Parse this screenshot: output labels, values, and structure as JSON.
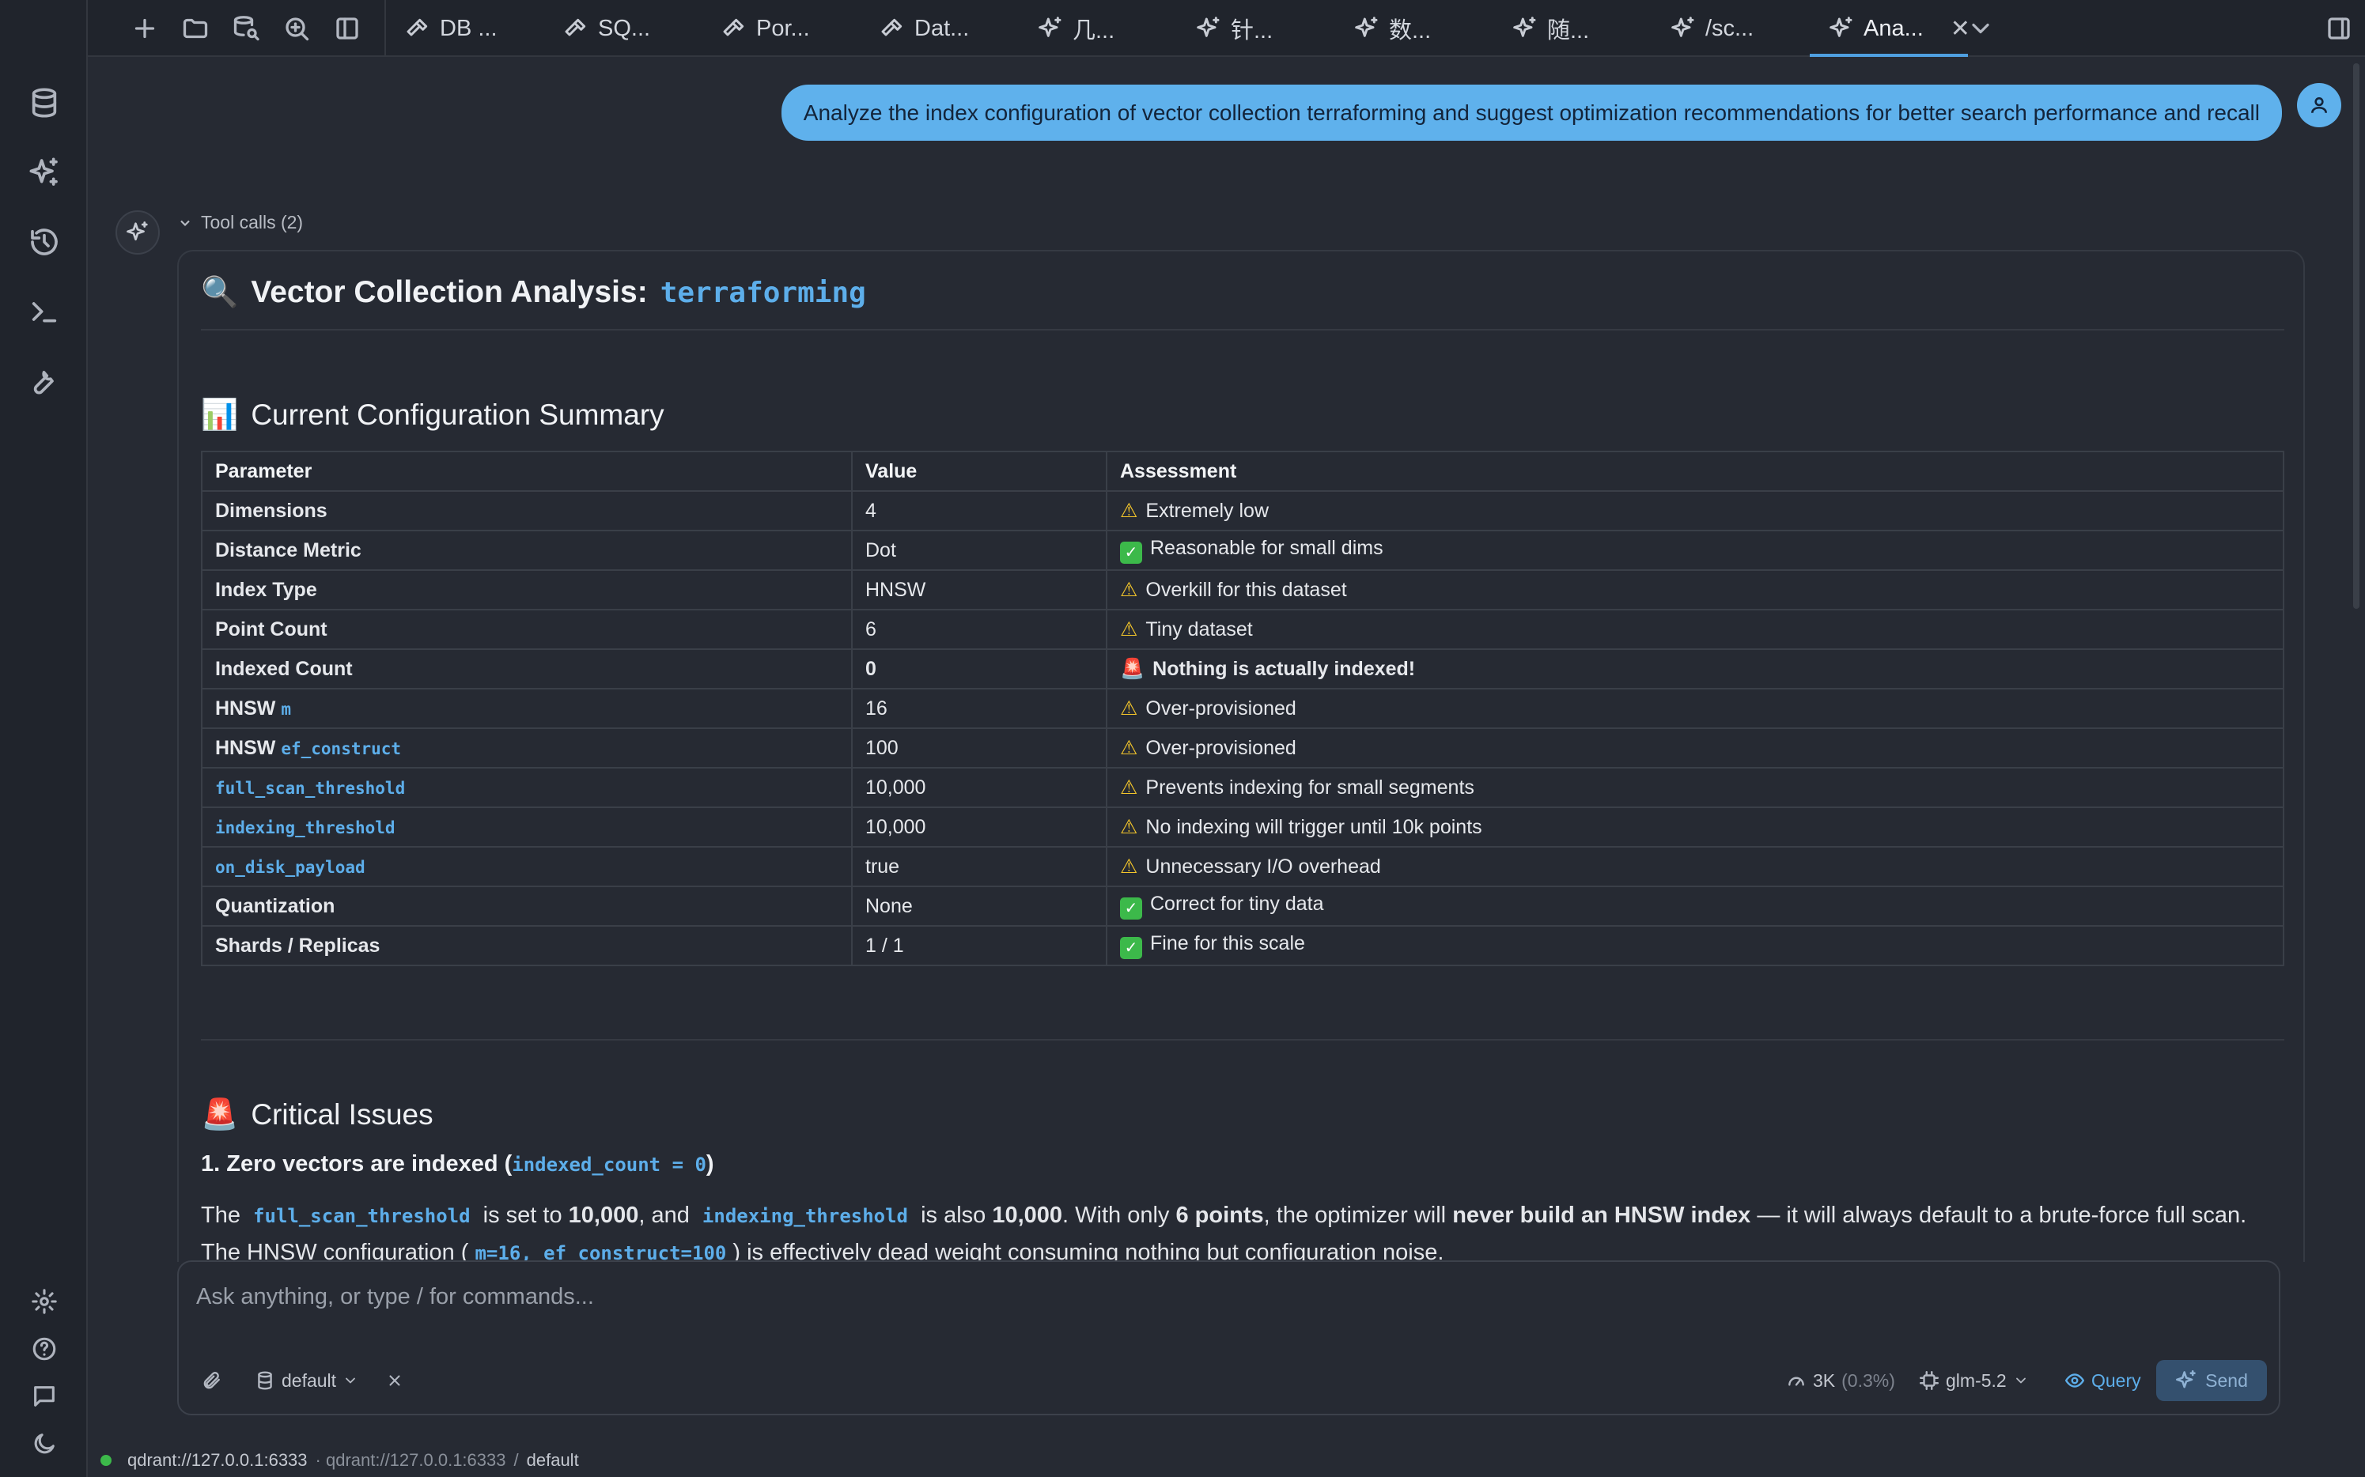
{
  "tabs": [
    {
      "label": "DB ...",
      "icon": "hammer-icon"
    },
    {
      "label": "SQ...",
      "icon": "hammer-icon"
    },
    {
      "label": "Por...",
      "icon": "hammer-icon"
    },
    {
      "label": "Dat...",
      "icon": "hammer-icon"
    },
    {
      "label": "几...",
      "icon": "sparkles-icon"
    },
    {
      "label": "针...",
      "icon": "sparkles-icon"
    },
    {
      "label": "数...",
      "icon": "sparkles-icon"
    },
    {
      "label": "随...",
      "icon": "sparkles-icon"
    },
    {
      "label": "/sc...",
      "icon": "sparkles-icon"
    },
    {
      "label": "Ana...",
      "icon": "sparkles-icon",
      "active": true,
      "closable": true
    }
  ],
  "user_message": "Analyze the index configuration of vector collection terraforming and suggest optimization recommendations for better search performance and recall",
  "tool_calls_label": "Tool calls (2)",
  "answer": {
    "title_emoji": "🔍",
    "title_text": "Vector Collection Analysis:",
    "title_code": "terraforming",
    "summary_emoji": "📊",
    "summary_heading": "Current Configuration Summary",
    "table": {
      "headers": [
        "Parameter",
        "Value",
        "Assessment"
      ],
      "rows": [
        {
          "param": "Dimensions",
          "value": "4",
          "mark": "warn",
          "assessment": "Extremely low"
        },
        {
          "param": "Distance Metric",
          "value": "Dot",
          "mark": "ok",
          "assessment": "Reasonable for small dims"
        },
        {
          "param": "Index Type",
          "value": "HNSW",
          "mark": "warn",
          "assessment": "Overkill for this dataset"
        },
        {
          "param": "Point Count",
          "value": "6",
          "mark": "warn",
          "assessment": "Tiny dataset"
        },
        {
          "param": "Indexed Count",
          "value": "0",
          "mark": "red",
          "assessment": "Nothing is actually indexed!",
          "strong": true
        },
        {
          "param": "HNSW",
          "param_code": "m",
          "value": "16",
          "mark": "warn",
          "assessment": "Over-provisioned"
        },
        {
          "param": "HNSW",
          "param_code": "ef_construct",
          "value": "100",
          "mark": "warn",
          "assessment": "Over-provisioned"
        },
        {
          "param": "",
          "param_code": "full_scan_threshold",
          "value": "10,000",
          "mark": "warn",
          "assessment": "Prevents indexing for small segments"
        },
        {
          "param": "",
          "param_code": "indexing_threshold",
          "value": "10,000",
          "mark": "warn",
          "assessment": "No indexing will trigger until 10k points"
        },
        {
          "param": "",
          "param_code": "on_disk_payload",
          "value": "true",
          "mark": "warn",
          "assessment": "Unnecessary I/O overhead"
        },
        {
          "param": "Quantization",
          "value": "None",
          "mark": "ok",
          "assessment": "Correct for tiny data"
        },
        {
          "param": "Shards / Replicas",
          "value": "1 / 1",
          "mark": "ok",
          "assessment": "Fine for this scale"
        }
      ]
    },
    "critical_emoji": "🚨",
    "critical_heading": "Critical Issues",
    "issue1_prefix": "1. Zero vectors are indexed (",
    "issue1_code": "indexed_count = 0",
    "issue1_suffix": ")",
    "para1": {
      "t1": "The",
      "c1": "full_scan_threshold",
      "t2": "is set to",
      "b1": "10,000",
      "t3": ", and",
      "c2": "indexing_threshold",
      "t4": "is also",
      "b2": "10,000",
      "t5": ". With only",
      "b3": "6 points",
      "t6": ", the optimizer will",
      "b4": "never build an HNSW index",
      "t7": "— it will always default to a brute-force full scan.",
      "t8": "The HNSW configuration (",
      "c3": "m=16, ef_construct=100",
      "t9": ") is effectively dead weight consuming nothing but configuration noise."
    }
  },
  "composer": {
    "placeholder": "Ask anything, or type / for commands...",
    "collection_label": "default",
    "tokens": "3K",
    "tokens_pct": "(0.3%)",
    "model": "glm-5.2",
    "mode": "Query",
    "send": "Send"
  },
  "status": {
    "connection": "qdrant://127.0.0.1:6333",
    "crumb_conn": "· qdrant://127.0.0.1:6333",
    "sep": "/",
    "crumb_db": "default"
  },
  "colors": {
    "accent": "#5fb1ec",
    "ok": "#3cb94a",
    "warn": "#f4c62b",
    "danger": "#e8413d"
  }
}
